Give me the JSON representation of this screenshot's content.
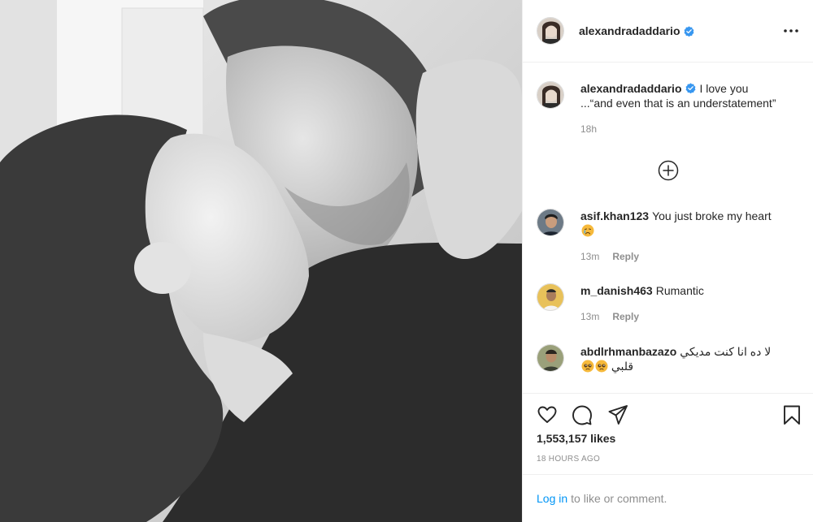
{
  "post": {
    "author": "alexandradaddario",
    "more_icon": "ellipsis-icon",
    "caption_line1": "I love you",
    "caption_line2": "...“and even that is an understatement”",
    "caption_time": "18h",
    "likes": "1,553,157 likes",
    "posted": "18 HOURS AGO"
  },
  "comments": [
    {
      "username": "asif.khan123",
      "text": "You just broke my heart",
      "emoji": "crying-face",
      "time": "13m",
      "reply": "Reply"
    },
    {
      "username": "m_danish463",
      "text": "Rumantic",
      "time": "13m",
      "reply": "Reply"
    },
    {
      "username": "abdlrhmanbazazo",
      "text": "لا ده انا كنت مديكي",
      "text2": "قلبي"
    }
  ],
  "login": {
    "link": "Log in",
    "suffix": "to like or comment."
  },
  "colors": {
    "verified": "#3897f0",
    "link": "#0095f6",
    "muted": "#8e8e8e",
    "text": "#262626"
  }
}
